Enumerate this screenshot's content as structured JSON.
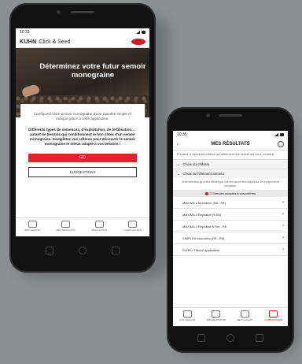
{
  "phone_left": {
    "status": {
      "time": "10:33"
    },
    "appbar": {
      "brand": "KUHN",
      "title": "Click & Seed"
    },
    "hero": {
      "title": "Déterminez votre futur semoir monograine"
    },
    "intro": {
      "text": "Configurez votre semoir monograine d'une manière simple et ludique grâce à cette application.",
      "bold": "Différents types de semences, d'exploitation, de fertilisation... : autant de besoins qui conditionnent le bon choix d'un semoir monograine. Complétez vos critères pour découvrir le semoir monograine le mieux adapté à vos besoins !"
    },
    "buttons": {
      "primary": "GO",
      "secondary": "SUGGESTIONS"
    },
    "tabs": [
      "MON SEMOIR",
      "MES RÉSULTATS",
      "MES FAVORIS",
      "COMPARATEUR"
    ]
  },
  "phone_right": {
    "status": {
      "time": "10:35"
    },
    "header": {
      "title": "MES RÉSULTATS",
      "info": "i"
    },
    "intro": "Précisez ci-après les critères qui déterminent le semoir qui vous convient.",
    "choices": [
      "Choix du châssis",
      "Choix de l'élément semeur"
    ],
    "sub_text": "Votre sélection peut être affinée par vos précisions techniques sur les équipements souhaités.",
    "match_bar": "2 Semoirs adaptés à vos critères",
    "results": [
      "MAXIMA 2 Monobloc (R8 - R8)",
      "MAXIMA 2 Repliable (6 R8)",
      "MAXIMA 2 Repliable 8 Rm - R8",
      "SIMPLEX Monobloc (R8 - R8)",
      "ELITE+ Tractor application"
    ],
    "tabs": [
      "MON SEMOIR",
      "MES RÉSULTATS",
      "MES FAVORIS",
      "COMPARATEUR"
    ],
    "active_tab": "COMPARATEUR"
  },
  "colors": {
    "accent": "#e3242b",
    "background": "#8c9091"
  }
}
